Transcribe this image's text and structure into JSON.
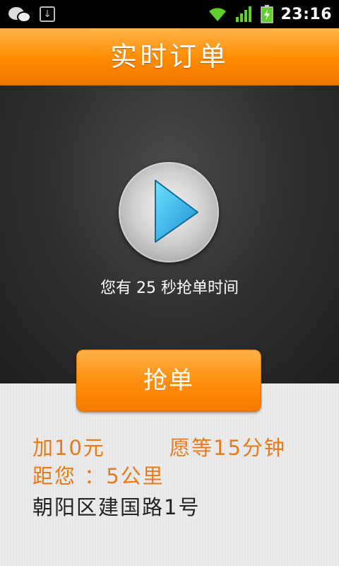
{
  "status_bar": {
    "time": "23:16",
    "left_icons": [
      "wechat-icon",
      "download-icon"
    ],
    "right_icons": [
      "wifi-icon",
      "signal-icon",
      "battery-icon"
    ]
  },
  "header": {
    "title": "实时订单"
  },
  "main": {
    "countdown_text": "您有 25 秒抢单时间",
    "grab_button_label": "抢单"
  },
  "order": {
    "bonus": "加10元",
    "wait": "愿等15分钟",
    "distance": "距您 ：5公里",
    "address": "朝阳区建国路1号"
  },
  "colors": {
    "accent": "#ff8a00",
    "info_text": "#e97a1a"
  }
}
